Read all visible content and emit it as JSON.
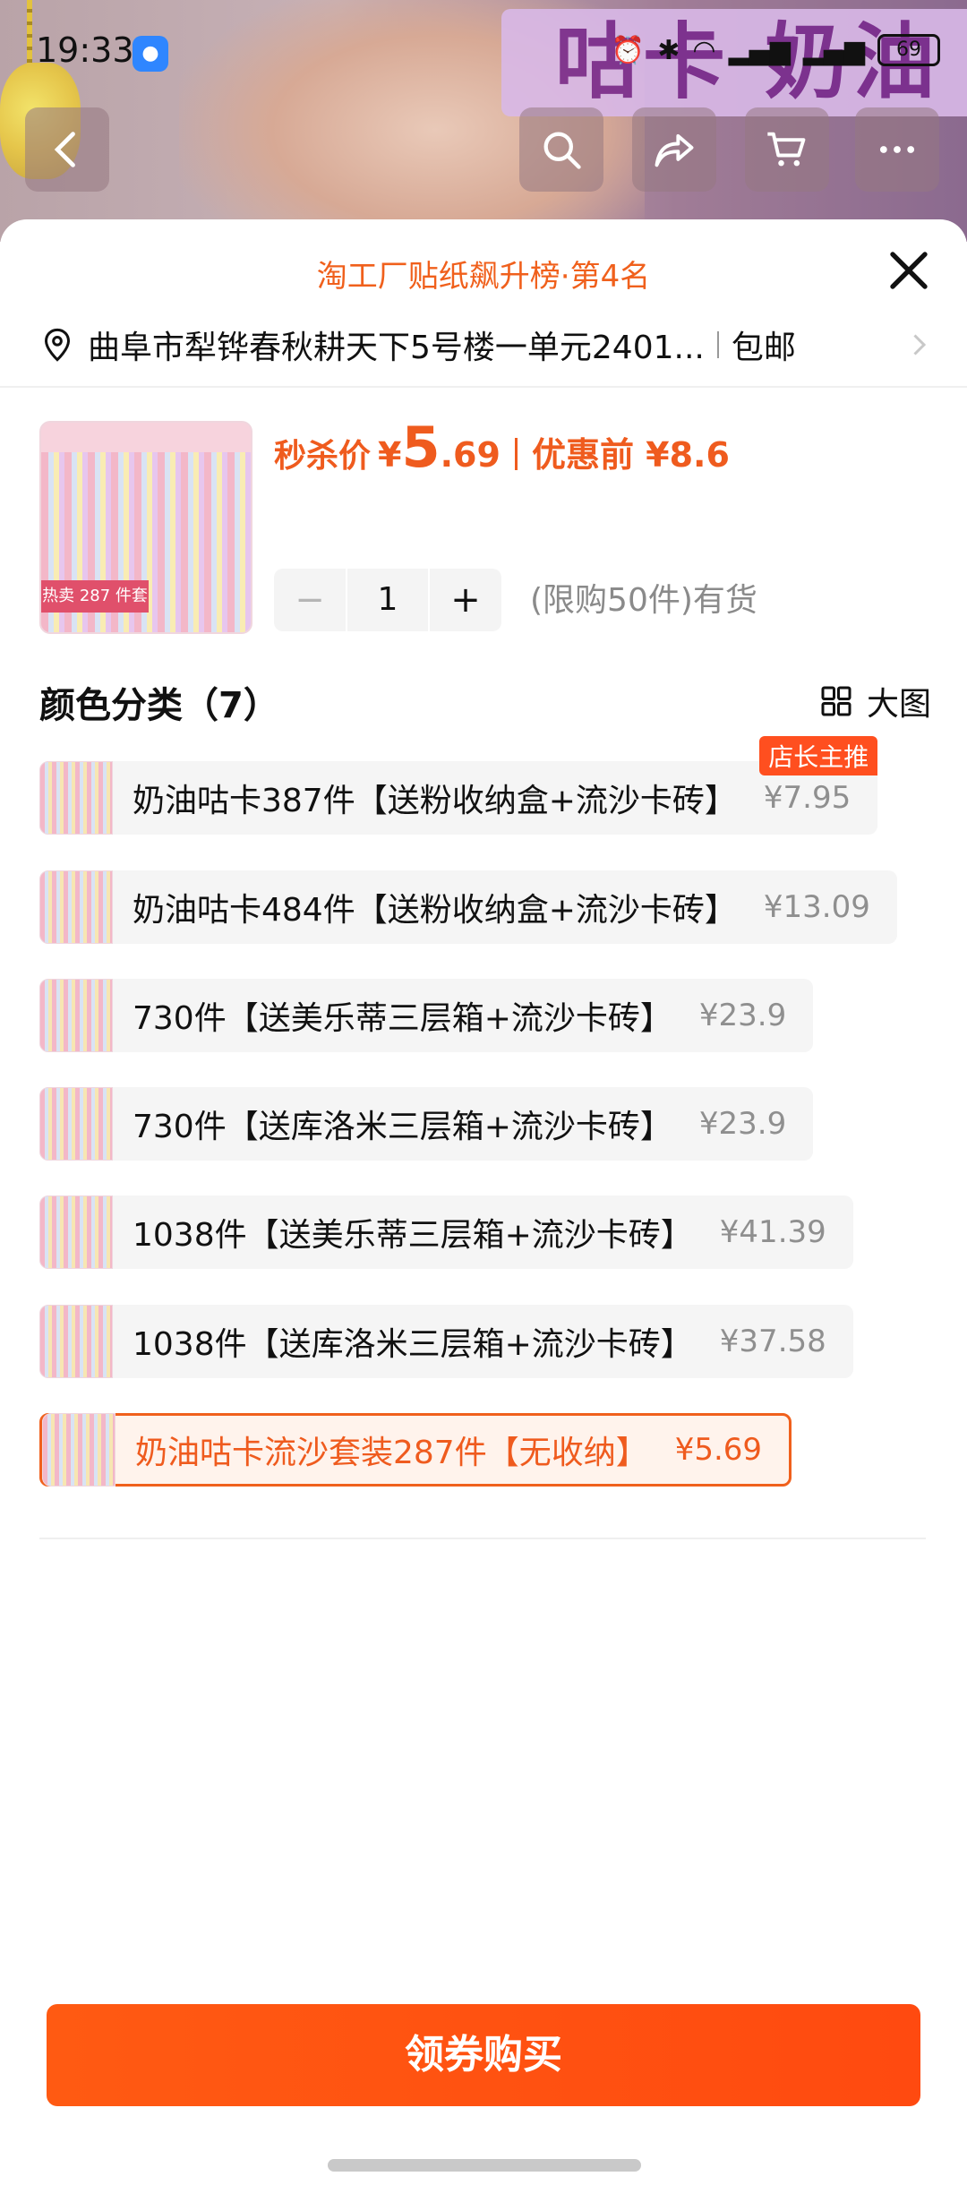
{
  "status_bar": {
    "time": "19:33",
    "battery": "69"
  },
  "sheet": {
    "rank_text": "淘工厂贴纸飙升榜·第4名",
    "address": "曲阜市犁铧春秋耕天下5号楼一单元2401...",
    "shipping": "包邮"
  },
  "product": {
    "price_label": "秒杀价",
    "price_yen": "¥",
    "price_int": "5",
    "price_dec": ".69",
    "before_label": "优惠前 ¥8.6",
    "quantity": "1",
    "minus": "−",
    "plus": "+",
    "stock_text": "(限购50件)有货",
    "thumb_tag": "热卖 287 件套"
  },
  "options_section": {
    "title": "颜色分类（7）",
    "bigview_label": "大图"
  },
  "options": [
    {
      "name": "奶油咕卡387件【送粉收纳盒+流沙卡砖】",
      "price": "¥7.95",
      "badge": "店长主推",
      "selected": false
    },
    {
      "name": "奶油咕卡484件【送粉收纳盒+流沙卡砖】",
      "price": "¥13.09",
      "badge": "",
      "selected": false
    },
    {
      "name": "730件【送美乐蒂三层箱+流沙卡砖】",
      "price": "¥23.9",
      "badge": "",
      "selected": false
    },
    {
      "name": "730件【送库洛米三层箱+流沙卡砖】",
      "price": "¥23.9",
      "badge": "",
      "selected": false
    },
    {
      "name": "1038件【送美乐蒂三层箱+流沙卡砖】",
      "price": "¥41.39",
      "badge": "",
      "selected": false
    },
    {
      "name": "1038件【送库洛米三层箱+流沙卡砖】",
      "price": "¥37.58",
      "badge": "",
      "selected": false
    },
    {
      "name": "奶油咕卡流沙套装287件【无收纳】",
      "price": "¥5.69",
      "badge": "",
      "selected": true
    }
  ],
  "buy_button": "领券购买",
  "colors": {
    "accent": "#ef5b1e",
    "button": "#ff5012",
    "badge": "#ff4f1f"
  },
  "icons": [
    "back-icon",
    "search-icon",
    "share-icon",
    "cart-icon",
    "more-icon",
    "close-icon",
    "location-pin-icon",
    "chevron-right-icon",
    "grid-icon"
  ]
}
